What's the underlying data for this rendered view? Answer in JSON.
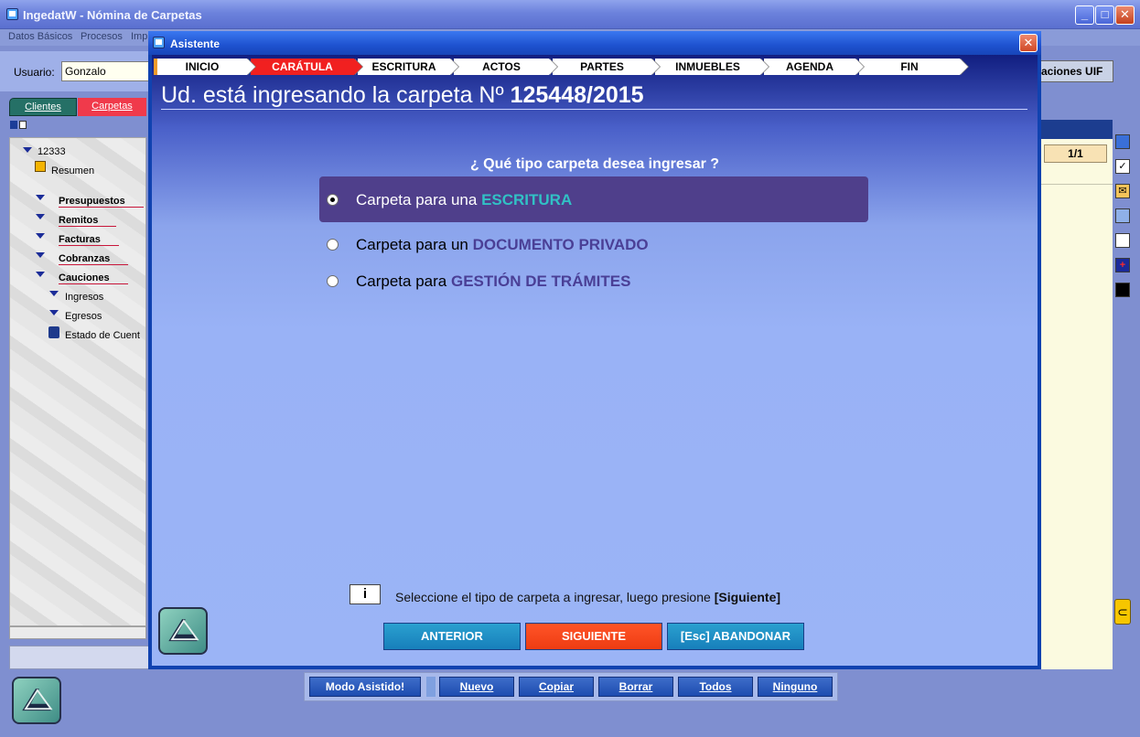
{
  "main_window": {
    "title": "IngedatW - Nómina de Carpetas",
    "min_glyph": "_",
    "max_glyph": "□",
    "close_glyph": "✕"
  },
  "menu": {
    "items": [
      "Datos Básicos",
      "Procesos",
      "Imp"
    ]
  },
  "user": {
    "label": "Usuario:",
    "value": "Gonzalo"
  },
  "left_tabs": {
    "clientes": "Clientes",
    "carpetas": "Carpetas"
  },
  "tree": {
    "root": "12333",
    "resumen": "Resumen",
    "items": [
      "Presupuestos",
      "Remitos",
      "Facturas",
      "Cobranzas",
      "Cauciones"
    ],
    "subitems": [
      "Ingresos",
      "Egresos"
    ],
    "estado": "Estado de Cuent"
  },
  "right": {
    "uif_button": "aciones UIF",
    "page_counter": "1/1"
  },
  "toolbar": {
    "modo_asistido": "Modo Asistido!",
    "nuevo": "Nuevo",
    "copiar": "Copiar",
    "borrar": "Borrar",
    "todos": "Todos",
    "ninguno": "Ninguno"
  },
  "dialog": {
    "title": "Asistente",
    "close_glyph": "✕",
    "steps": [
      "INICIO",
      "CARÁTULA",
      "ESCRITURA",
      "ACTOS",
      "PARTES",
      "INMUEBLES",
      "AGENDA",
      "FIN"
    ],
    "active_step": 1,
    "heading_prefix": "Ud. está ingresando la carpeta Nº",
    "folder_number": "125448/2015",
    "question": "¿ Qué tipo carpeta desea ingresar ?",
    "options": [
      {
        "prefix": "Carpeta para una",
        "keyword": "ESCRITURA",
        "selected": true
      },
      {
        "prefix": "Carpeta para un",
        "keyword": "DOCUMENTO PRIVADO",
        "selected": false
      },
      {
        "prefix": "Carpeta para",
        "keyword": "GESTIÓN DE TRÁMITES",
        "selected": false
      }
    ],
    "info_icon": "i",
    "info_text": "Seleccione el tipo de carpeta a ingresar, luego presione",
    "info_key": "[Siguiente]",
    "buttons": {
      "anterior": "ANTERIOR",
      "siguiente": "SIGUIENTE",
      "abandonar": "[Esc] ABANDONAR"
    }
  },
  "colors": {
    "accent_red": "#f12020",
    "selected_option_bg": "#4f3f8b",
    "keyword_selected": "#31c1c5",
    "keyword": "#4a3f96",
    "button_blue": "#177fbb",
    "button_orange": "#ee3c12"
  },
  "icons": [
    "app-window-icon",
    "folder-icon",
    "calculator-icon",
    "checklist-icon",
    "mail-icon",
    "save-icon",
    "clipboard-icon",
    "add-icon",
    "eraser-icon",
    "paperclip-icon",
    "info-icon",
    "logo-icon",
    "radio-icon",
    "expand-triangle-icon"
  ]
}
